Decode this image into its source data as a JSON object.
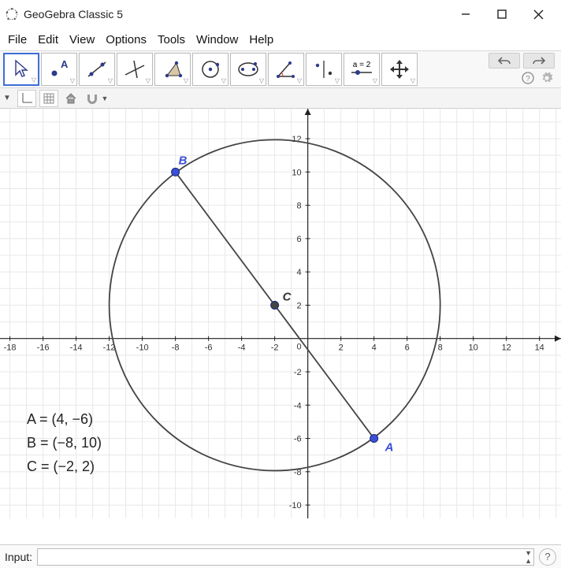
{
  "window": {
    "title": "GeoGebra Classic 5"
  },
  "menu": {
    "file": "File",
    "edit": "Edit",
    "view": "View",
    "options": "Options",
    "tools": "Tools",
    "window": "Window",
    "help": "Help"
  },
  "tool_icons": {
    "a_eq": "a = 2"
  },
  "input": {
    "label": "Input:",
    "value": ""
  },
  "algebra": {
    "A": "A  =  (4, −6)",
    "B": "B  =  (−8, 10)",
    "C": "C  =  (−2, 2)"
  },
  "points": {
    "A_label": "A",
    "B_label": "B",
    "C_label": "C"
  },
  "chart_data": {
    "type": "scatter",
    "title": "",
    "xlabel": "",
    "ylabel": "",
    "axes": {
      "x_ticks": [
        -18,
        -16,
        -14,
        -12,
        -10,
        -8,
        -6,
        -4,
        -2,
        0,
        2,
        4,
        6,
        8,
        10,
        12,
        14
      ],
      "y_ticks": [
        -10,
        -8,
        -6,
        -4,
        -2,
        2,
        4,
        6,
        8,
        10,
        12
      ]
    },
    "objects": [
      {
        "kind": "point",
        "name": "A",
        "x": 4,
        "y": -6,
        "color": "#3b4fd6"
      },
      {
        "kind": "point",
        "name": "B",
        "x": -8,
        "y": 10,
        "color": "#3b4fd6"
      },
      {
        "kind": "point",
        "name": "C",
        "x": -2,
        "y": 2,
        "color": "#444444"
      },
      {
        "kind": "circle",
        "center": "C",
        "cx": -2,
        "cy": 2,
        "radius": 10,
        "stroke": "#444444"
      },
      {
        "kind": "segment",
        "from": "B",
        "to": "A",
        "stroke": "#444444"
      }
    ],
    "viewport": {
      "xmin": -18.6,
      "xmax": 15.3,
      "ymin": -10.8,
      "ymax": 13.8,
      "grid": true
    }
  }
}
